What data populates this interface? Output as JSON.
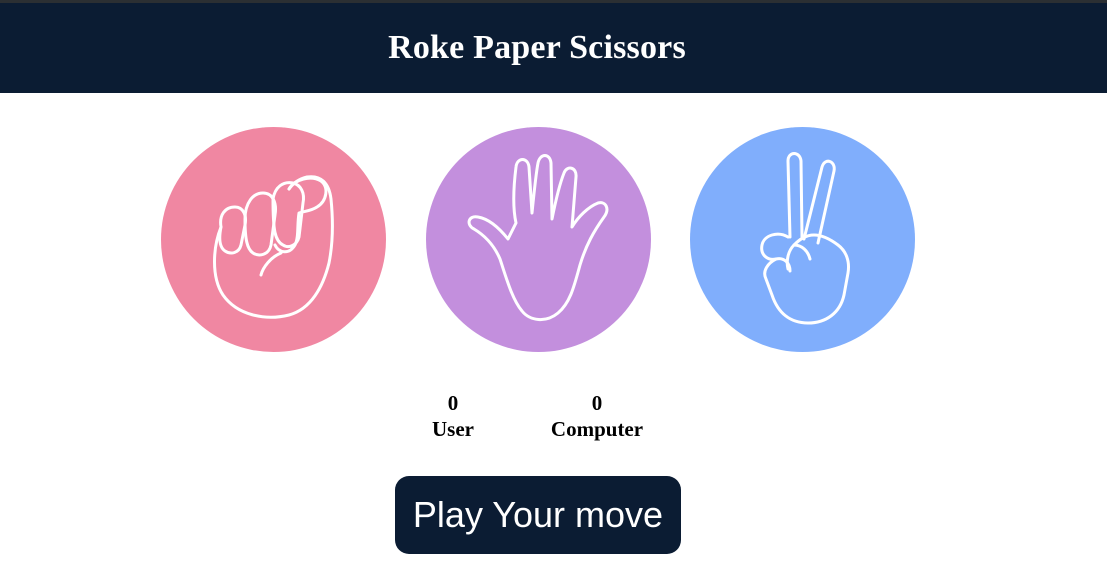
{
  "header": {
    "title": "Roke Paper Scissors"
  },
  "choices": [
    {
      "id": "rock",
      "icon": "fist-icon",
      "color": "#f087a2"
    },
    {
      "id": "paper",
      "icon": "open-hand-icon",
      "color": "#c38fdd"
    },
    {
      "id": "scissors",
      "icon": "peace-hand-icon",
      "color": "#80aefc"
    }
  ],
  "score": {
    "user_value": "0",
    "user_label": "User",
    "computer_value": "0",
    "computer_label": "Computer"
  },
  "message": {
    "text": "Play Your move"
  },
  "colors": {
    "header_bg": "#0b1c33",
    "message_bg": "#0b1c33"
  }
}
